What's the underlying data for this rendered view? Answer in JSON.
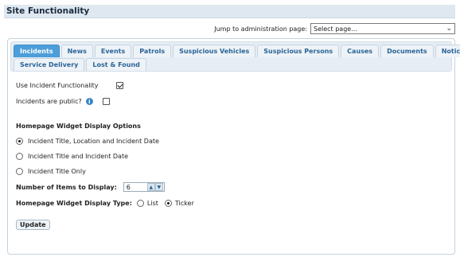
{
  "page": {
    "title": "Site Functionality"
  },
  "jump": {
    "label": "Jump to administration page:",
    "selected": "Select page..."
  },
  "tabs": [
    {
      "label": "Incidents",
      "active": true
    },
    {
      "label": "News"
    },
    {
      "label": "Events"
    },
    {
      "label": "Patrols"
    },
    {
      "label": "Suspicious Vehicles"
    },
    {
      "label": "Suspicious Persons"
    },
    {
      "label": "Causes"
    },
    {
      "label": "Documents"
    },
    {
      "label": "Notices"
    },
    {
      "label": "Service Delivery"
    },
    {
      "label": "Lost & Found"
    }
  ],
  "form": {
    "use_incident": {
      "label": "Use Incident Functionality",
      "checked": true
    },
    "incidents_public": {
      "label": "Incidents are public?",
      "checked": false,
      "info_icon": "info-icon"
    },
    "widget_options_heading": "Homepage Widget Display Options",
    "widget_options": [
      {
        "label": "Incident Title, Location and Incident Date",
        "checked": true
      },
      {
        "label": "Incident Title and Incident Date",
        "checked": false
      },
      {
        "label": "Incident Title Only",
        "checked": false
      }
    ],
    "items_to_display": {
      "label": "Number of Items to Display:",
      "value": "6"
    },
    "display_type": {
      "label": "Homepage Widget Display Type:",
      "options": [
        {
          "label": "List",
          "checked": false
        },
        {
          "label": "Ticker",
          "checked": true
        }
      ]
    },
    "update_label": "Update"
  },
  "colors": {
    "active_tab": "#4c9ed9",
    "tab_text": "#2a6496",
    "title_bar": "#dfe8f1"
  }
}
